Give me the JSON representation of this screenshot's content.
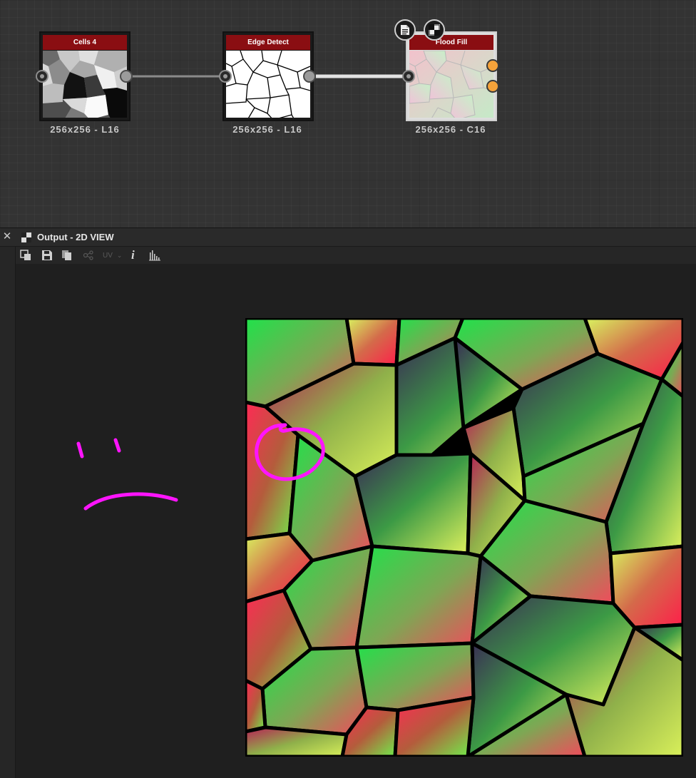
{
  "graph": {
    "nodes": [
      {
        "id": "cells",
        "title": "Cells 4",
        "caption": "256x256 - L16"
      },
      {
        "id": "edge",
        "title": "Edge Detect",
        "caption": "256x256 - L16"
      },
      {
        "id": "flood",
        "title": "Flood Fill",
        "caption": "256x256 - C16"
      }
    ],
    "badges": [
      "document-icon",
      "2d-view-icon"
    ],
    "port_output_color": "#f6a33a",
    "title_bar_color": "#8a0e12"
  },
  "panel": {
    "title": "Output - 2D VIEW",
    "toolbar": {
      "items": [
        "export-icon",
        "save-icon",
        "copy-icon",
        "link-icon",
        "uv-dropdown",
        "info-icon",
        "histogram-icon"
      ],
      "uv_label": "UV"
    }
  },
  "annotation": {
    "color": "#ff14ff"
  }
}
